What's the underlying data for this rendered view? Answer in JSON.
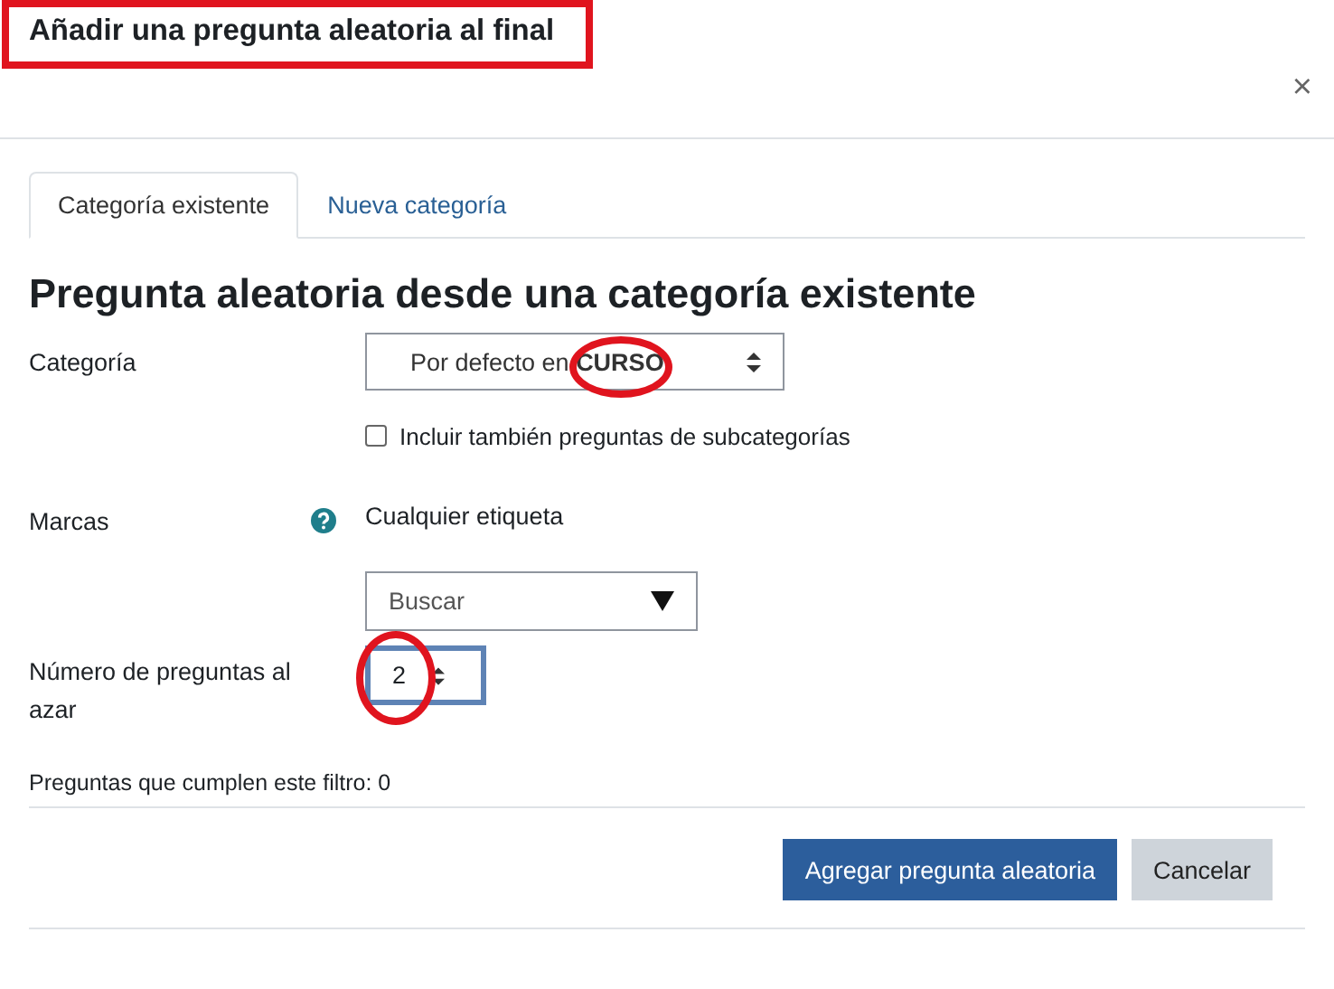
{
  "dialog": {
    "title": "Añadir una pregunta aleatoria al final",
    "title_highlighted": true,
    "close": "×"
  },
  "tabs": [
    {
      "label": "Categoría existente",
      "selected": true
    },
    {
      "label": "Nueva categoría",
      "selected": false
    }
  ],
  "heading": "Pregunta aleatoria desde una categoría existente",
  "category": {
    "label": "Categoría",
    "value": "Por defecto en **CURSO**",
    "highlighted": true
  },
  "subcategories": {
    "label": "Incluir también preguntas de subcategorías",
    "checked": false
  },
  "tags": {
    "label": "Marcas",
    "value": "Cualquier etiqueta",
    "search_placeholder": "Buscar"
  },
  "count": {
    "label": "Número de preguntas al azar",
    "value": "2",
    "highlighted": true
  },
  "filter_summary": "Preguntas que cumplen este filtro: 0",
  "buttons": [
    {
      "label": "Agregar pregunta aleatoria",
      "kind": "primary"
    },
    {
      "label": "Cancelar",
      "kind": "secondary"
    }
  ]
}
